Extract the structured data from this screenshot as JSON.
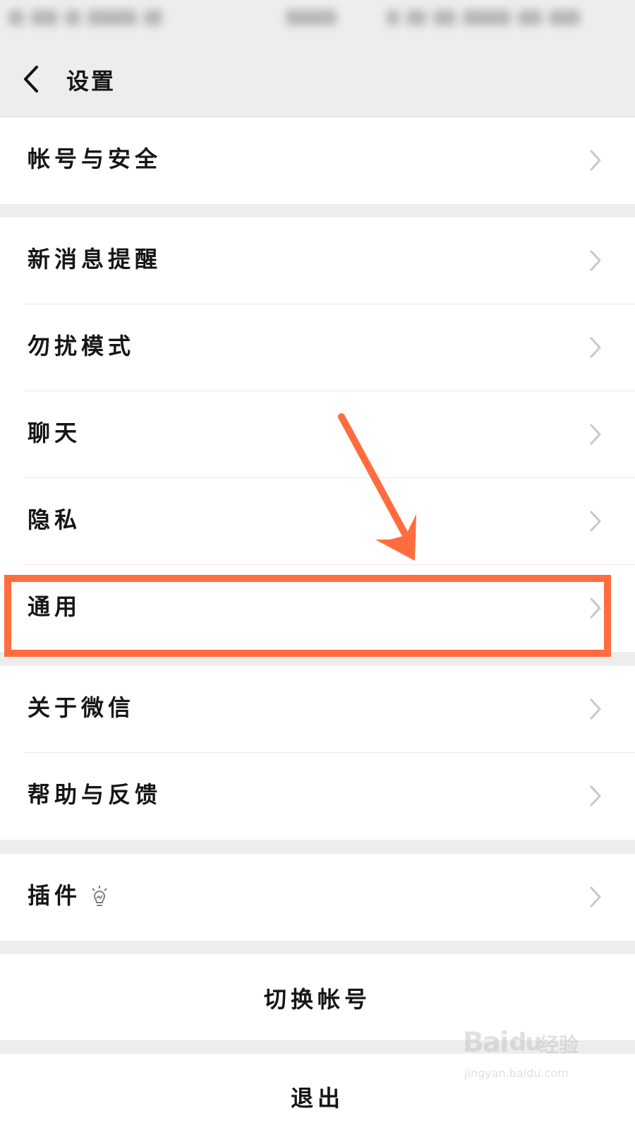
{
  "header": {
    "title": "设置"
  },
  "sections": [
    {
      "items": [
        {
          "label": "帐号与安全",
          "chevron": true
        }
      ]
    },
    {
      "items": [
        {
          "label": "新消息提醒",
          "chevron": true
        },
        {
          "label": "勿扰模式",
          "chevron": true
        },
        {
          "label": "聊天",
          "chevron": true
        },
        {
          "label": "隐私",
          "chevron": true
        },
        {
          "label": "通用",
          "chevron": true,
          "highlighted": true
        }
      ]
    },
    {
      "items": [
        {
          "label": "关于微信",
          "chevron": true
        },
        {
          "label": "帮助与反馈",
          "chevron": true
        }
      ]
    },
    {
      "items": [
        {
          "label": "插件",
          "chevron": true,
          "icon": "lightbulb-icon"
        }
      ]
    }
  ],
  "actions": {
    "switch_account": "切换帐号",
    "logout": "退出"
  },
  "annotation": {
    "highlight_color": "#ff6d3f"
  },
  "watermark": {
    "brand": "Bai",
    "paw": "du",
    "suffix": "经验",
    "url": "jingyan.baidu.com"
  }
}
